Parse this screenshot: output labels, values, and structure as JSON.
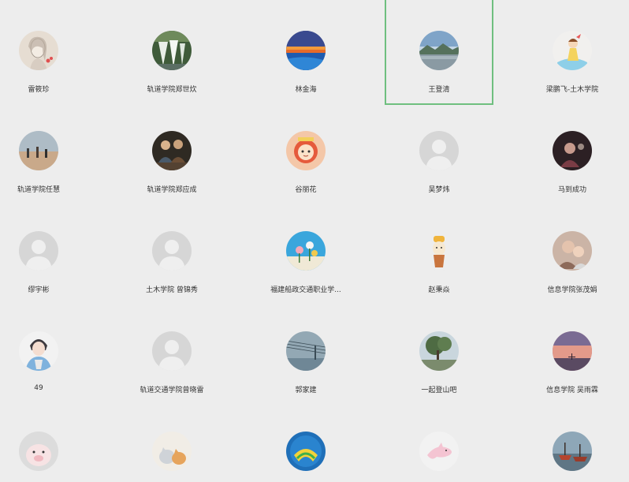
{
  "contacts": [
    {
      "name": "雷筱珍",
      "avatar_icon": "sketch-portrait-avatar",
      "selected": false
    },
    {
      "name": "轨道学院郑世炊",
      "avatar_icon": "waterfall-avatar",
      "selected": false
    },
    {
      "name": "林金海",
      "avatar_icon": "sunset-sea-avatar",
      "selected": false
    },
    {
      "name": "王登清",
      "avatar_icon": "lake-mountain-avatar",
      "selected": true
    },
    {
      "name": "梁鹏飞-土木学院",
      "avatar_icon": "cartoon-girl-avatar",
      "selected": false
    },
    {
      "name": "轨道学院任慧",
      "avatar_icon": "beach-people-avatar",
      "selected": false
    },
    {
      "name": "轨道学院郑应成",
      "avatar_icon": "group-photo-avatar",
      "selected": false
    },
    {
      "name": "谷丽花",
      "avatar_icon": "cartoon-lion-avatar",
      "selected": false
    },
    {
      "name": "吴梦炜",
      "avatar_icon": "default-user-avatar",
      "selected": false
    },
    {
      "name": "马到成功",
      "avatar_icon": "night-photo-avatar",
      "selected": false
    },
    {
      "name": "缪宇彬",
      "avatar_icon": "default-user-avatar",
      "selected": false
    },
    {
      "name": "土木学院 曾锦秀",
      "avatar_icon": "default-user-avatar",
      "selected": false
    },
    {
      "name": "福建船政交通职业学...",
      "avatar_icon": "flowers-sky-avatar",
      "selected": false
    },
    {
      "name": "赵秉焱",
      "avatar_icon": "cartoon-duck-avatar",
      "selected": false
    },
    {
      "name": "信息学院张茂娟",
      "avatar_icon": "mother-child-avatar",
      "selected": false
    },
    {
      "name": "49",
      "avatar_icon": "illustrated-boy-avatar",
      "selected": false
    },
    {
      "name": "轨道交通学院曾晓雷",
      "avatar_icon": "default-user-avatar",
      "selected": false
    },
    {
      "name": "郭家建",
      "avatar_icon": "power-lines-avatar",
      "selected": false
    },
    {
      "name": "一起登山吧",
      "avatar_icon": "tree-landscape-avatar",
      "selected": false
    },
    {
      "name": "信息学院 吴雨霖",
      "avatar_icon": "dusk-sky-avatar",
      "selected": false
    },
    {
      "name": "",
      "avatar_icon": "cartoon-pig-avatar",
      "selected": false
    },
    {
      "name": "",
      "avatar_icon": "cats-avatar",
      "selected": false
    },
    {
      "name": "",
      "avatar_icon": "school-logo-avatar",
      "selected": false
    },
    {
      "name": "",
      "avatar_icon": "pink-dolphin-avatar",
      "selected": false
    },
    {
      "name": "",
      "avatar_icon": "harbor-boats-avatar",
      "selected": false
    }
  ]
}
